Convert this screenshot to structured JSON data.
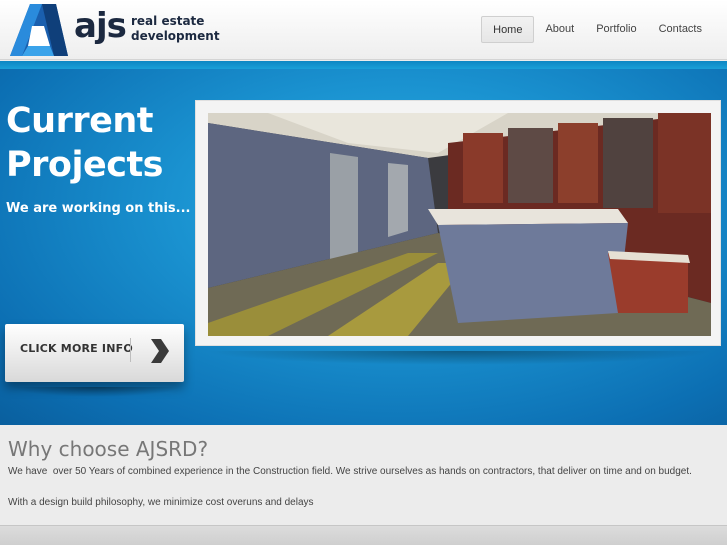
{
  "logo": {
    "wordmark": "ajs",
    "tagline_line1": "real estate",
    "tagline_line2": "development"
  },
  "nav": {
    "items": [
      "Home",
      "About",
      "Portfolio",
      "Contacts"
    ],
    "active": "Home"
  },
  "hero": {
    "title_line1": "Current",
    "title_line2": "Projects",
    "subtitle": "We are working on this...",
    "cta_label": "CLICK MORE INFO"
  },
  "why": {
    "title": "Why choose AJSRD?",
    "paragraph1": "We have  over 50 Years of combined experience in the Construction field. We strive ourselves as hands on contractors, that deliver on time and on budget.",
    "paragraph2": "With a design build philosophy, we minimize cost overuns and delays"
  },
  "colors": {
    "brand_navy": "#1c2940",
    "hero_blue": "#1a92d0",
    "logo_blue": "#1e73c0"
  },
  "icons": {
    "logo_mark": "triangle-logo-icon",
    "cta_arrow": "chevron-right-icon"
  }
}
